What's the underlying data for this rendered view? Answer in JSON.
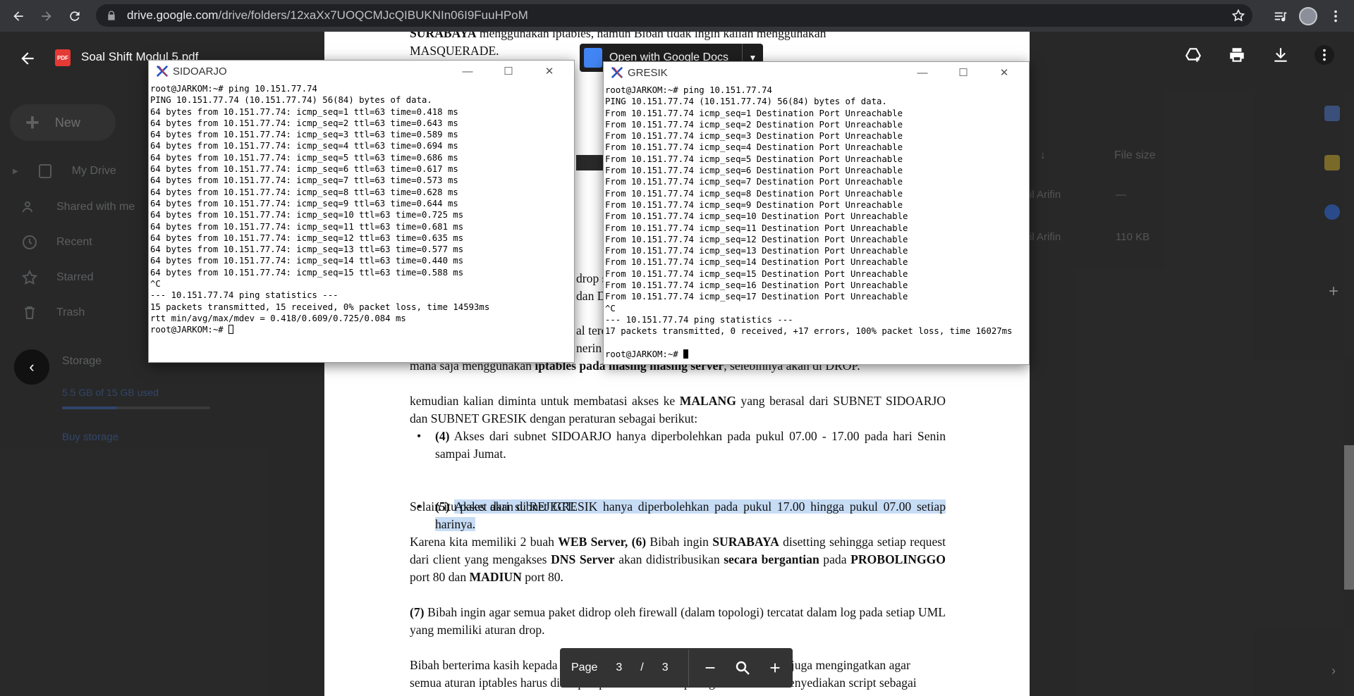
{
  "browser": {
    "url_host": "drive.google.com",
    "url_path": "/drive/folders/12xaXx7UOQCMJcQIBUKNIn06I9FuuHPoM"
  },
  "drive": {
    "new_label": "New",
    "nav": [
      "My Drive",
      "Shared with me",
      "Recent",
      "Starred",
      "Trash"
    ],
    "storage_label": "Storage",
    "storage_used": "5.5 GB of 15 GB used",
    "storage_fraction": 0.37,
    "buy_storage": "Buy storage",
    "col_file_size": "File size",
    "rows": [
      {
        "owner": "il Arifin",
        "size": "—"
      },
      {
        "owner": "il Arifin",
        "size": "110 KB"
      }
    ]
  },
  "viewer": {
    "file_title": "Soal Shift Modul 5.pdf",
    "pdf_badge": "PDF",
    "open_with": "Open with Google Docs",
    "page_label": "Page",
    "page_current": "3",
    "page_sep": "/",
    "page_total": "3"
  },
  "pdf": {
    "top_line1_a": "SURABAYA",
    "top_line1_b": " menggunakan iptables, namun Bibah tidak ingin kalian menggunakan",
    "top_line2": "MASQUERADE.",
    "frag1": "drop s",
    "frag2": "dan D",
    "frag3": "al terc",
    "frag4": "nerin",
    "line_a": "mana saja menggunakan ",
    "line_a_bold": "iptables pada masing masing server",
    "line_a_end": ", selebihnya akan di DROP.",
    "p2_a": "kemudian kalian diminta untuk membatasi akses ke ",
    "p2_bold": "MALANG",
    "p2_b": " yang berasal dari SUBNET SIDOARJO dan SUBNET GRESIK dengan peraturan sebagai berikut:",
    "b1_num": "(4)",
    "b1_text": " Akses dari subnet SIDOARJO hanya diperbolehkan pada pukul 07.00 - 17.00 pada hari Senin sampai Jumat.",
    "b2_num": "(5)",
    "b2_text": "Akses dari subnet GRESIK hanya diperbolehkan pada pukul 17.00 hingga pukul 07.00 setiap harinya.",
    "reject_line": "Selain itu paket akan di REJECT.",
    "p3_a": "Karena kita memiliki 2 buah ",
    "p3_b1": "WEB Server,",
    "p3_b2": " (6)",
    "p3_c": " Bibah ingin ",
    "p3_b3": "SURABAYA",
    "p3_d": " disetting sehingga setiap request dari client yang mengakses ",
    "p3_b4": "DNS Server",
    "p3_e": " akan didistribusikan ",
    "p3_b5": "secara bergantian",
    "p3_f": " pada ",
    "p3_b6": "PROBOLINGGO",
    "p3_g": " port 80 dan ",
    "p3_b7": "MADIUN",
    "p3_h": " port 80.",
    "p4_num": "(7)",
    "p4_text": " Bibah ingin agar semua paket didrop oleh firewall (dalam topologi) tercatat dalam log pada setiap UML yang memiliki aturan drop.",
    "p5_a": "Bibah berterima kasih kepada kalian karena telah mau membantunya. Bibah juga mengingatkan agar",
    "p5_b": "semua aturan iptables harus disimpan pada sistem atau paling tidak kalian menyediakan script sebagai"
  },
  "sidoarjo": {
    "title": "SIDOARJO",
    "lines": [
      "root@JARKOM:~# ping 10.151.77.74",
      "PING 10.151.77.74 (10.151.77.74) 56(84) bytes of data.",
      "64 bytes from 10.151.77.74: icmp_seq=1 ttl=63 time=0.418 ms",
      "64 bytes from 10.151.77.74: icmp_seq=2 ttl=63 time=0.643 ms",
      "64 bytes from 10.151.77.74: icmp_seq=3 ttl=63 time=0.589 ms",
      "64 bytes from 10.151.77.74: icmp_seq=4 ttl=63 time=0.694 ms",
      "64 bytes from 10.151.77.74: icmp_seq=5 ttl=63 time=0.686 ms",
      "64 bytes from 10.151.77.74: icmp_seq=6 ttl=63 time=0.617 ms",
      "64 bytes from 10.151.77.74: icmp_seq=7 ttl=63 time=0.573 ms",
      "64 bytes from 10.151.77.74: icmp_seq=8 ttl=63 time=0.628 ms",
      "64 bytes from 10.151.77.74: icmp_seq=9 ttl=63 time=0.644 ms",
      "64 bytes from 10.151.77.74: icmp_seq=10 ttl=63 time=0.725 ms",
      "64 bytes from 10.151.77.74: icmp_seq=11 ttl=63 time=0.681 ms",
      "64 bytes from 10.151.77.74: icmp_seq=12 ttl=63 time=0.635 ms",
      "64 bytes from 10.151.77.74: icmp_seq=13 ttl=63 time=0.577 ms",
      "64 bytes from 10.151.77.74: icmp_seq=14 ttl=63 time=0.440 ms",
      "64 bytes from 10.151.77.74: icmp_seq=15 ttl=63 time=0.588 ms",
      "^C",
      "--- 10.151.77.74 ping statistics ---",
      "15 packets transmitted, 15 received, 0% packet loss, time 14593ms",
      "rtt min/avg/max/mdev = 0.418/0.609/0.725/0.084 ms"
    ],
    "prompt": "root@JARKOM:~# "
  },
  "gresik": {
    "title": "GRESIK",
    "lines": [
      "root@JARKOM:~# ping 10.151.77.74",
      "PING 10.151.77.74 (10.151.77.74) 56(84) bytes of data.",
      "From 10.151.77.74 icmp_seq=1 Destination Port Unreachable",
      "From 10.151.77.74 icmp_seq=2 Destination Port Unreachable",
      "From 10.151.77.74 icmp_seq=3 Destination Port Unreachable",
      "From 10.151.77.74 icmp_seq=4 Destination Port Unreachable",
      "From 10.151.77.74 icmp_seq=5 Destination Port Unreachable",
      "From 10.151.77.74 icmp_seq=6 Destination Port Unreachable",
      "From 10.151.77.74 icmp_seq=7 Destination Port Unreachable",
      "From 10.151.77.74 icmp_seq=8 Destination Port Unreachable",
      "From 10.151.77.74 icmp_seq=9 Destination Port Unreachable",
      "From 10.151.77.74 icmp_seq=10 Destination Port Unreachable",
      "From 10.151.77.74 icmp_seq=11 Destination Port Unreachable",
      "From 10.151.77.74 icmp_seq=12 Destination Port Unreachable",
      "From 10.151.77.74 icmp_seq=13 Destination Port Unreachable",
      "From 10.151.77.74 icmp_seq=14 Destination Port Unreachable",
      "From 10.151.77.74 icmp_seq=15 Destination Port Unreachable",
      "From 10.151.77.74 icmp_seq=16 Destination Port Unreachable",
      "From 10.151.77.74 icmp_seq=17 Destination Port Unreachable",
      "^C",
      "--- 10.151.77.74 ping statistics ---",
      "17 packets transmitted, 0 received, +17 errors, 100% packet loss, time 16027ms",
      ""
    ],
    "prompt": "root@JARKOM:~# "
  }
}
